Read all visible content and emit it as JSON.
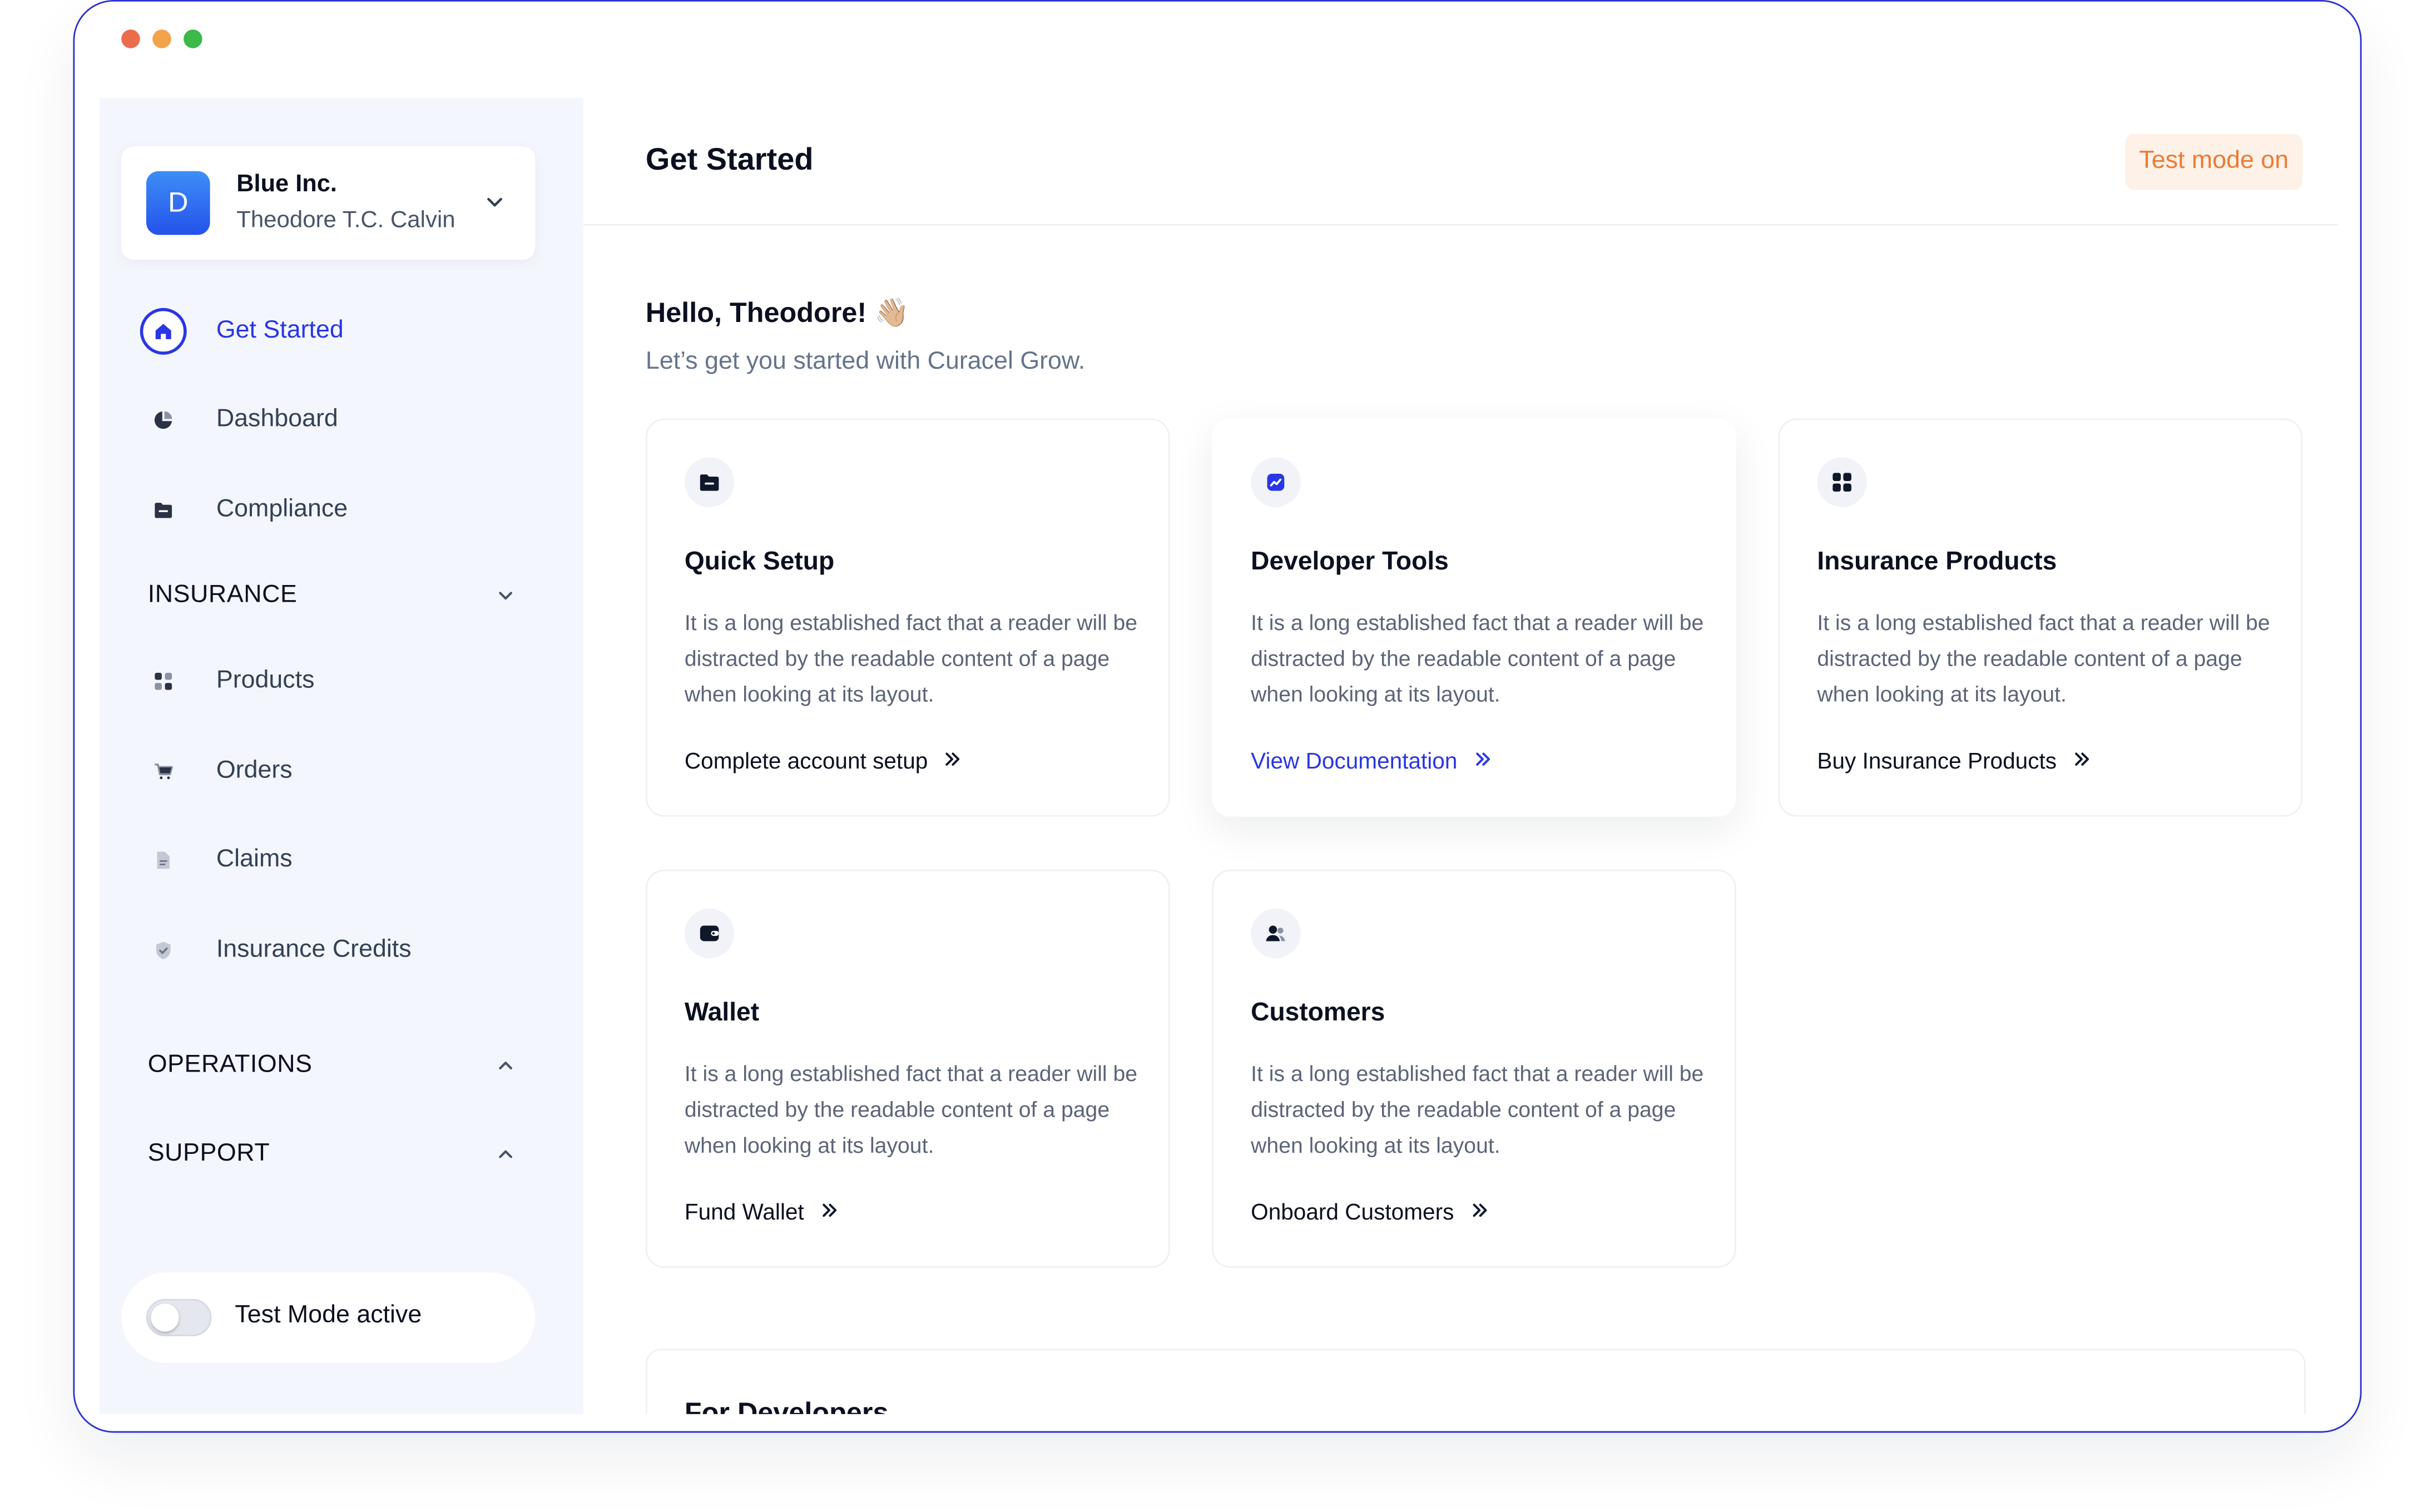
{
  "window": {
    "traffic_lights": [
      "#ec6b4c",
      "#f2a34c",
      "#3bb94a"
    ]
  },
  "sidebar": {
    "org_initial": "D",
    "org_name": "Blue Inc.",
    "user_name": "Theodore T.C. Calvin",
    "nav": {
      "get_started": "Get Started",
      "dashboard": "Dashboard",
      "compliance": "Compliance"
    },
    "sections": {
      "insurance": "INSURANCE",
      "operations": "OPERATIONS",
      "support": "SUPPORT"
    },
    "insurance_items": {
      "products": "Products",
      "orders": "Orders",
      "claims": "Claims",
      "credits": "Insurance Credits"
    },
    "test_mode_label": "Test Mode active",
    "test_mode_on": false
  },
  "header": {
    "title": "Get Started",
    "badge": "Test mode on"
  },
  "main": {
    "greeting": "Hello, Theodore! 👋🏼",
    "subtitle": "Let’s get you started with Curacel Grow.",
    "cards": [
      {
        "icon": "folder-icon",
        "title": "Quick Setup",
        "description": "It is a long established fact that a reader will be distracted by the readable content of a page when looking at its layout.",
        "link": "Complete account setup"
      },
      {
        "icon": "developer-chart-icon",
        "title": "Developer Tools",
        "description": "It is a long established fact that a reader will be distracted by the readable content of a page when looking at its layout.",
        "link": "View Documentation"
      },
      {
        "icon": "grid-icon",
        "title": "Insurance Products",
        "description": "It is a long established fact that a reader will be distracted by the readable content of a page when looking at its layout.",
        "link": "Buy Insurance Products"
      },
      {
        "icon": "wallet-icon",
        "title": "Wallet",
        "description": "It is a long established fact that a reader will be distracted by the readable content of a page when looking at its layout.",
        "link": "Fund Wallet"
      },
      {
        "icon": "users-icon",
        "title": "Customers",
        "description": "It is a long established fact that a reader will be distracted by the readable content of a page when looking at its layout.",
        "link": "Onboard Customers"
      }
    ],
    "dev_section_title": "For Developers"
  },
  "colors": {
    "accent": "#2936e6",
    "window_border": "#2a2fd1",
    "sidebar_bg": "#f4f6fd",
    "badge_text": "#ec7b33",
    "badge_bg": "#fdf1e8"
  }
}
